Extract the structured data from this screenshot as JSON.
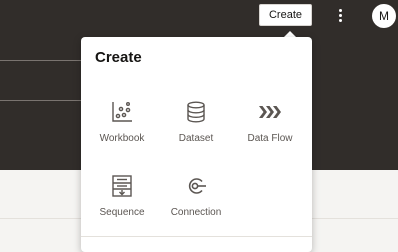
{
  "header": {
    "create_label": "Create",
    "avatar_initial": "M"
  },
  "create_menu": {
    "title": "Create",
    "items": [
      {
        "label": "Workbook",
        "icon": "workbook-icon"
      },
      {
        "label": "Dataset",
        "icon": "dataset-icon"
      },
      {
        "label": "Data Flow",
        "icon": "data-flow-icon"
      },
      {
        "label": "Sequence",
        "icon": "sequence-icon"
      },
      {
        "label": "Connection",
        "icon": "connection-icon"
      }
    ]
  },
  "colors": {
    "header_bg": "#312d2a",
    "popup_bg": "#ffffff",
    "icon": "#5b5652",
    "text": "#161513"
  }
}
